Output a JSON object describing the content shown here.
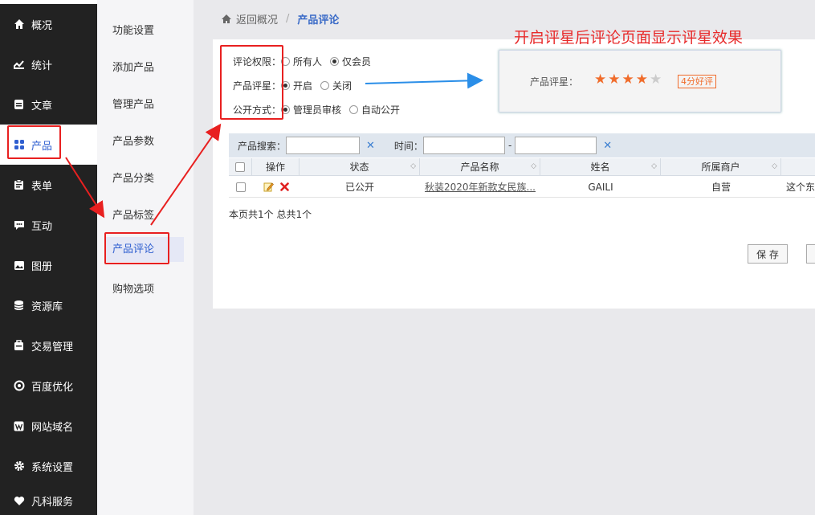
{
  "sidebar": {
    "items": [
      {
        "label": "概况",
        "icon": "home-icon"
      },
      {
        "label": "统计",
        "icon": "chart-icon"
      },
      {
        "label": "文章",
        "icon": "article-icon"
      },
      {
        "label": "产品",
        "icon": "grid-icon",
        "active": true
      },
      {
        "label": "表单",
        "icon": "clipboard-icon"
      },
      {
        "label": "互动",
        "icon": "chat-icon"
      },
      {
        "label": "图册",
        "icon": "image-icon"
      },
      {
        "label": "资源库",
        "icon": "database-icon"
      },
      {
        "label": "交易管理",
        "icon": "bag-icon"
      },
      {
        "label": "百度优化",
        "icon": "target-icon"
      },
      {
        "label": "网站域名",
        "icon": "w-icon"
      },
      {
        "label": "系统设置",
        "icon": "gear-icon"
      },
      {
        "label": "凡科服务",
        "icon": "heart-icon"
      }
    ]
  },
  "submenu": {
    "items": [
      "功能设置",
      "添加产品",
      "管理产品",
      "产品参数",
      "产品分类",
      "产品标签",
      "产品评论",
      "购物选项"
    ],
    "active": "产品评论"
  },
  "breadcrumb": {
    "back": "返回概况",
    "separator": "/",
    "current": "产品评论"
  },
  "settings": {
    "comment_permission": {
      "label": "评论权限：",
      "options": [
        "所有人",
        "仅会员"
      ],
      "selected": "仅会员"
    },
    "rating": {
      "label": "产品评星：",
      "options": [
        "开启",
        "关闭"
      ],
      "selected": "开启"
    },
    "publish": {
      "label": "公开方式：",
      "options": [
        "管理员审核",
        "自动公开"
      ],
      "selected": "管理员审核"
    }
  },
  "annotation": {
    "title": "开启评星后评论页面显示评星效果"
  },
  "preview": {
    "label": "产品评星：",
    "rating": 4,
    "max": 5,
    "badge": "4分好评"
  },
  "search": {
    "label": "产品搜索：",
    "time_label": "时间：",
    "dash": "-",
    "clear": "✕"
  },
  "table": {
    "headers": [
      "操作",
      "状态",
      "产品名称",
      "姓名",
      "所属商户"
    ],
    "rows": [
      {
        "status": "已公开",
        "product": "秋装2020年新款女民族...",
        "name": "GAILI",
        "merchant": "自营",
        "extra": "这个东"
      }
    ]
  },
  "pager": {
    "text": "本页共1个 总共1个"
  },
  "buttons": {
    "save": "保 存"
  },
  "colors": {
    "accent": "#2f5fd0",
    "annotation_red": "#e82020",
    "star": "#f06c2b",
    "arrow": "#2a8ee8"
  }
}
